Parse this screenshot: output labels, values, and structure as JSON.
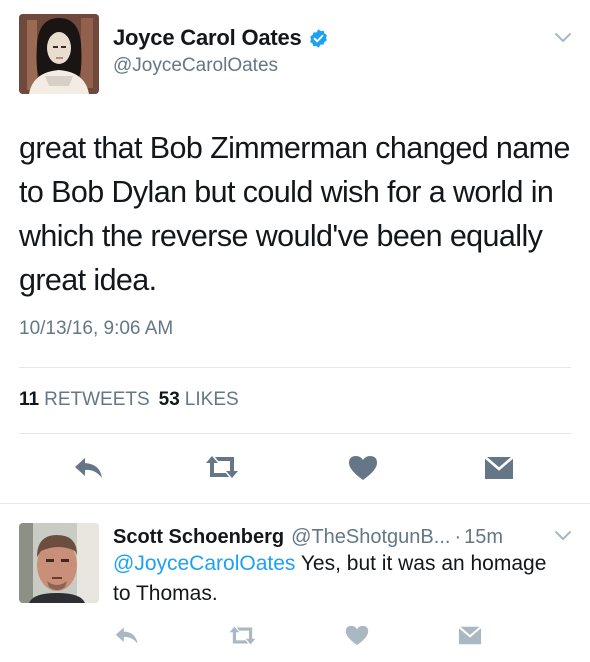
{
  "tweet": {
    "author_name": "Joyce Carol Oates",
    "author_handle": "@JoyceCarolOates",
    "verified_icon": "verified-badge-icon",
    "text": "great that Bob Zimmerman changed name to Bob Dylan but could wish for a world in which the reverse would've been equally great idea.",
    "timestamp": "10/13/16, 9:06 AM",
    "retweets_count": "11",
    "retweets_label": "RETWEETS",
    "likes_count": "53",
    "likes_label": "LIKES"
  },
  "reply": {
    "author_name": "Scott Schoenberg",
    "author_handle": "@TheShotgunB...",
    "separator": "·",
    "time": "15m",
    "mention": "@JoyceCarolOates",
    "text": " Yes, but it was an homage to Thomas."
  },
  "colors": {
    "accent": "#1da1f2",
    "muted_text": "#657786",
    "action_icon": "#657786",
    "reply_action_icon": "#aab8c2",
    "divider": "#e1e8ed"
  }
}
